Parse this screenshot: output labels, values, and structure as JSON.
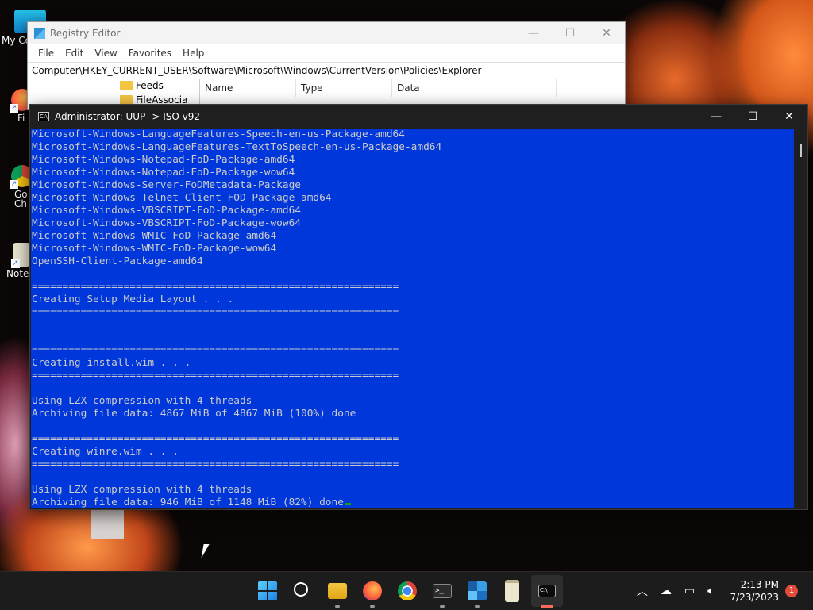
{
  "desktop": {
    "icons": [
      {
        "label": "My Co",
        "icon": "monitor-icon"
      },
      {
        "label": "Fi",
        "icon": "firefox-icon"
      },
      {
        "label": "Go",
        "icon": "chrome-icon"
      },
      {
        "label": "Ch",
        "icon": "chrome-icon"
      },
      {
        "label": "Note",
        "icon": "notepad-icon"
      }
    ]
  },
  "regedit": {
    "title": "Registry Editor",
    "menu": [
      "File",
      "Edit",
      "View",
      "Favorites",
      "Help"
    ],
    "address": "Computer\\HKEY_CURRENT_USER\\Software\\Microsoft\\Windows\\CurrentVersion\\Policies\\Explorer",
    "tree": [
      "Feeds",
      "FileAssocia"
    ],
    "columns": [
      "Name",
      "Type",
      "Data"
    ]
  },
  "console": {
    "title": "Administrator:  UUP -> ISO v92",
    "lines": [
      "Microsoft-Windows-LanguageFeatures-Speech-en-us-Package-amd64",
      "Microsoft-Windows-LanguageFeatures-TextToSpeech-en-us-Package-amd64",
      "Microsoft-Windows-Notepad-FoD-Package-amd64",
      "Microsoft-Windows-Notepad-FoD-Package-wow64",
      "Microsoft-Windows-Server-FoDMetadata-Package",
      "Microsoft-Windows-Telnet-Client-FOD-Package-amd64",
      "Microsoft-Windows-VBSCRIPT-FoD-Package-amd64",
      "Microsoft-Windows-VBSCRIPT-FoD-Package-wow64",
      "Microsoft-Windows-WMIC-FoD-Package-amd64",
      "Microsoft-Windows-WMIC-FoD-Package-wow64",
      "OpenSSH-Client-Package-amd64",
      "",
      "============================================================",
      "Creating Setup Media Layout . . .",
      "============================================================",
      "",
      "",
      "============================================================",
      "Creating install.wim . . .",
      "============================================================",
      "",
      "Using LZX compression with 4 threads",
      "Archiving file data: 4867 MiB of 4867 MiB (100%) done",
      "",
      "============================================================",
      "Creating winre.wim . . .",
      "============================================================",
      "",
      "Using LZX compression with 4 threads",
      "Archiving file data: 946 MiB of 1148 MiB (82%) done"
    ],
    "colors": {
      "background": "#0037da",
      "text": "#cccccc",
      "cursor": "#13a10e"
    }
  },
  "taskbar": {
    "apps": [
      {
        "name": "start",
        "icon": "windows-start-icon",
        "active": false
      },
      {
        "name": "search",
        "icon": "search-icon",
        "active": false
      },
      {
        "name": "file-explorer",
        "icon": "folder-icon",
        "active": false
      },
      {
        "name": "firefox",
        "icon": "firefox-icon",
        "active": false
      },
      {
        "name": "chrome",
        "icon": "chrome-icon",
        "active": false
      },
      {
        "name": "terminal",
        "icon": "terminal-icon",
        "active": false
      },
      {
        "name": "registry-editor",
        "icon": "registry-icon",
        "active": false
      },
      {
        "name": "notepad",
        "icon": "notepad-icon",
        "active": false
      },
      {
        "name": "command-prompt",
        "icon": "cmd-icon",
        "active": true
      }
    ],
    "time": "2:13 PM",
    "date": "7/23/2023",
    "notifications": "1"
  }
}
